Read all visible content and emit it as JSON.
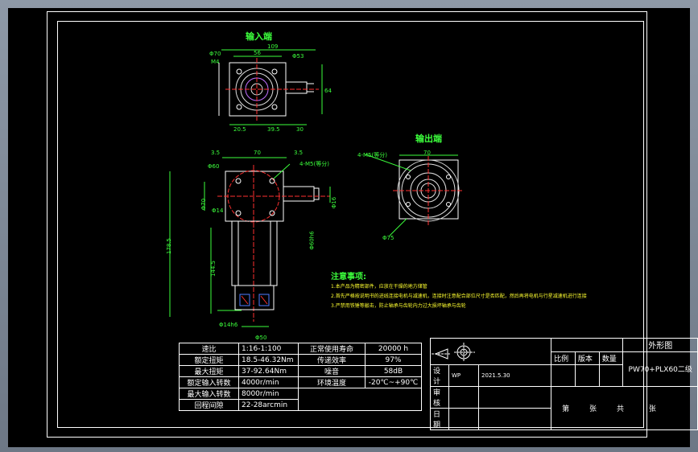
{
  "views": {
    "input_end": {
      "title": "输入端",
      "dims": [
        "109",
        "56",
        "Φ70",
        "M4",
        "Φ53",
        "20.5",
        "39.5",
        "30",
        "64"
      ]
    },
    "output_end": {
      "title": "输出端",
      "dims": [
        "4-M5(等分)",
        "70",
        "Φ75"
      ]
    },
    "front": {
      "dims": [
        "3.5",
        "70",
        "3.5",
        "Φ60",
        "4-M5(等分)",
        "Φ70",
        "Φ14",
        "Φ16",
        "178.5",
        "144.5",
        "Φ14h6",
        "Φ60h6",
        "Φ50"
      ]
    }
  },
  "notes": {
    "title": "注意事项:",
    "lines": [
      "1.本产品为精密部件，应放在干燥的地方储管",
      "2.首先严格按说明书的进线连接电机与减速机，连接时注意配合部位尺寸是否匹配，然后再将电机与行星减速机进行连接",
      "3.严禁用铁锤等敲击，防止轴承与齿轮内力过大损坏轴承与齿轮"
    ]
  },
  "spec_table": {
    "rows": [
      [
        "速比",
        "1:16-1:100",
        "正常使用寿命",
        "20000 h"
      ],
      [
        "额定扭矩",
        "18.5-46.32Nm",
        "传递效率",
        "97%"
      ],
      [
        "最大扭矩",
        "37-92.64Nm",
        "噪音",
        "58dB"
      ],
      [
        "额定输入转数",
        "4000r/min",
        "环境温度",
        "-20℃~+90℃"
      ],
      [
        "最大输入转数",
        "8000r/min",
        "",
        ""
      ],
      [
        "回程间隙",
        "22-28arcmin",
        "",
        ""
      ]
    ]
  },
  "title_block": {
    "drawing_title": "外形图",
    "model": "PW70+PLX60二级",
    "design_label": "设计",
    "designer": "WP",
    "date_value": "2021.5.30",
    "review_label": "审核",
    "date_label": "日期",
    "scale_label": "比例",
    "version_label": "版本",
    "qty_label": "数量",
    "sheet_label": "第",
    "sheets_unit": "张",
    "total_label": "共",
    "total_unit": "张"
  },
  "colors": {
    "background": "#000000",
    "frame_line": "#ffffff",
    "dimension": "#3cff3c",
    "note_text": "#ffff30",
    "center_line": "#ff3030"
  }
}
